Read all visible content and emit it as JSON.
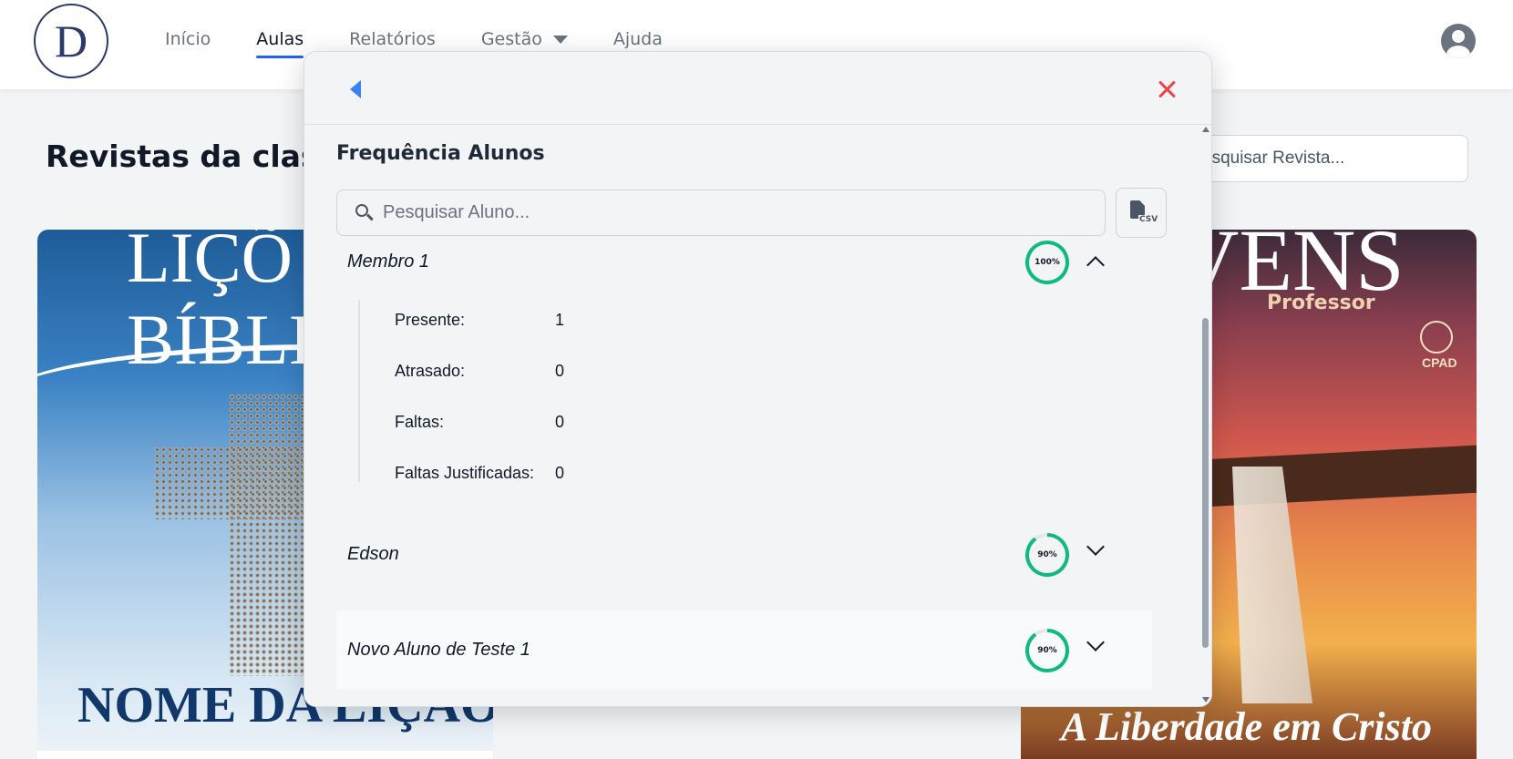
{
  "nav": {
    "logo_text": "D",
    "items": [
      {
        "label": "Início"
      },
      {
        "label": "Aulas",
        "active": true
      },
      {
        "label": "Relatórios"
      },
      {
        "label": "Gestão",
        "has_dropdown": true
      },
      {
        "label": "Ajuda"
      }
    ],
    "avatar_icon": "user-circle-icon"
  },
  "page": {
    "title": "Revistas da clas",
    "search_placeholder": "esquisar Revista...",
    "cards": [
      {
        "cover_top": "LIÇÕ",
        "cover_line2": "BÍBLIC",
        "cover_bottom": "NOME DA LIÇÃO"
      },
      {
        "cover_top": "VENS",
        "cover_sub": "Professor",
        "cover_brand": "CPAD",
        "cover_bottom": "A Liberdade em Cristo"
      }
    ]
  },
  "modal": {
    "back_icon": "caret-left-icon",
    "close_icon": "close-icon",
    "section_title": "Frequência Alunos",
    "search_placeholder": "Pesquisar Aluno...",
    "csv_icon": "csv-file-icon",
    "csv_label": "CSV",
    "accent_color": "#10b981",
    "students": [
      {
        "name": "Membro 1",
        "attendance_percent": 100,
        "attendance_label": "100%",
        "expanded": true,
        "details": [
          {
            "label": "Presente:",
            "value": "1"
          },
          {
            "label": "Atrasado:",
            "value": "0"
          },
          {
            "label": "Faltas:",
            "value": "0"
          },
          {
            "label": "Faltas Justificadas:",
            "value": "0"
          }
        ]
      },
      {
        "name": "Edson",
        "attendance_percent": 90,
        "attendance_label": "90%",
        "expanded": false
      },
      {
        "name": "Novo Aluno de Teste 1",
        "attendance_percent": 90,
        "attendance_label": "90%",
        "expanded": false
      }
    ]
  }
}
